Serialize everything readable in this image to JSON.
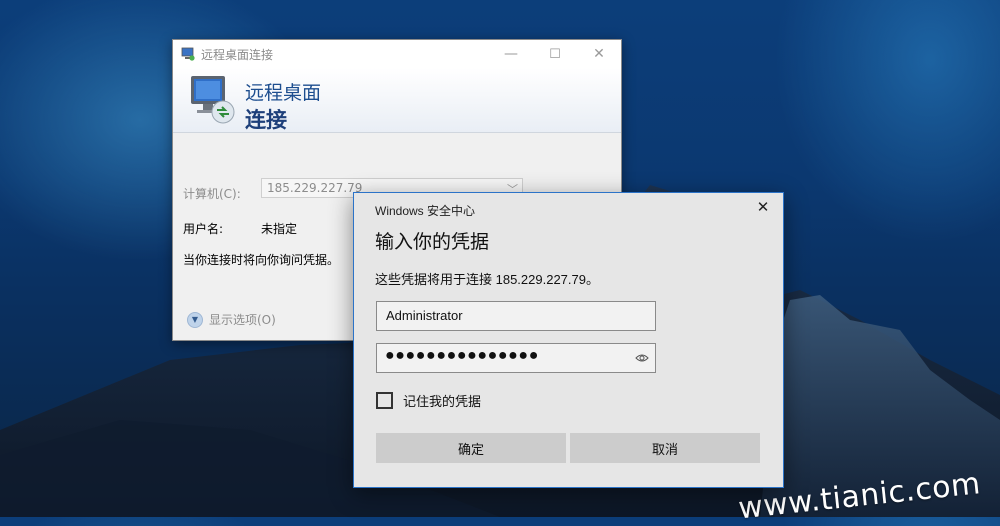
{
  "rdp_window": {
    "title": "远程桌面连接",
    "banner_line1": "远程桌面",
    "banner_line2": "连接",
    "computer_label": "计算机(C):",
    "computer_value": "185.229.227.79",
    "username_label": "用户名:",
    "username_value": "未指定",
    "hint": "当你连接时将向你询问凭据。",
    "show_options": "显示选项(O)"
  },
  "credential_dialog": {
    "header": "Windows 安全中心",
    "title": "输入你的凭据",
    "description": "这些凭据将用于连接 185.229.227.79。",
    "username_value": "Administrator",
    "password_masked": "●●●●●●●●●●●●●●●",
    "remember_label": "记住我的凭据",
    "remember_checked": false,
    "ok_label": "确定",
    "cancel_label": "取消"
  },
  "watermark": "www.tianic.com",
  "icons": {
    "rdp_app": "rdp-app-icon",
    "close": "close-icon",
    "minimize": "minimize-icon",
    "maximize": "maximize-icon",
    "dropdown": "chevron-down-icon",
    "reveal_password": "eye-icon",
    "expand_options": "chevron-down-circle-icon"
  },
  "colors": {
    "accent": "#2b73c8",
    "banner_text": "#1d4e8f"
  }
}
